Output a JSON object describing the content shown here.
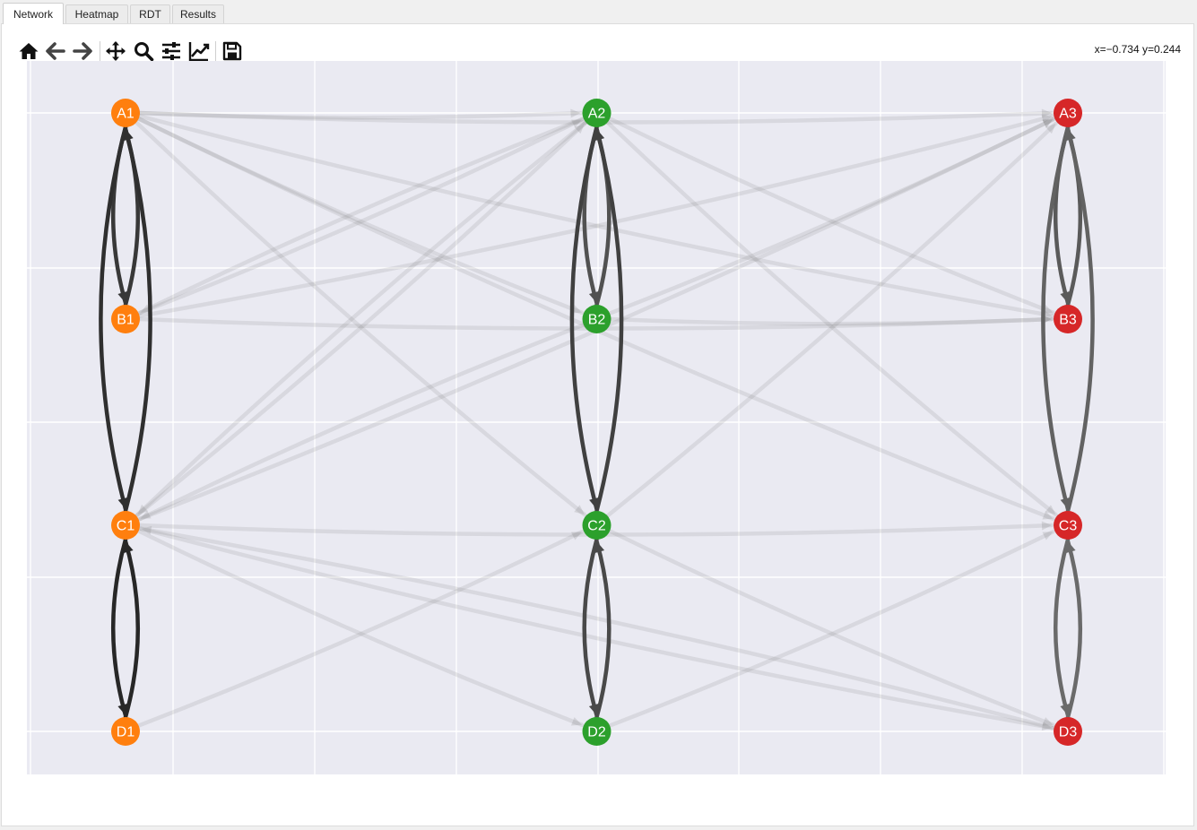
{
  "tabs": [
    {
      "label": "Network",
      "active": true
    },
    {
      "label": "Heatmap",
      "active": false
    },
    {
      "label": "RDT",
      "active": false
    },
    {
      "label": "Results",
      "active": false
    }
  ],
  "toolbar": {
    "tools": [
      {
        "name": "home",
        "icon": "home-icon"
      },
      {
        "name": "back",
        "icon": "arrow-left-icon"
      },
      {
        "name": "forward",
        "icon": "arrow-right-icon"
      },
      {
        "name": "pan",
        "icon": "move-icon"
      },
      {
        "name": "zoom",
        "icon": "magnifier-icon"
      },
      {
        "name": "subplots",
        "icon": "sliders-icon"
      },
      {
        "name": "axes",
        "icon": "line-chart-icon"
      },
      {
        "name": "save",
        "icon": "floppy-disk-icon"
      }
    ],
    "coordinates": "x=−0.734 y=0.244"
  },
  "colors": {
    "group1": "#ff7f0e",
    "group2": "#2ca02c",
    "group3": "#d62728",
    "plot_background": "#eaeaf2",
    "grid": "#ffffff"
  },
  "chart_data": {
    "type": "network",
    "nodes": [
      {
        "id": "A1",
        "x": 0,
        "y": 3,
        "group": 1
      },
      {
        "id": "B1",
        "x": 0,
        "y": 2,
        "group": 1
      },
      {
        "id": "C1",
        "x": 0,
        "y": 1,
        "group": 1
      },
      {
        "id": "D1",
        "x": 0,
        "y": 0,
        "group": 1
      },
      {
        "id": "A2",
        "x": 1,
        "y": 3,
        "group": 2
      },
      {
        "id": "B2",
        "x": 1,
        "y": 2,
        "group": 2
      },
      {
        "id": "C2",
        "x": 1,
        "y": 1,
        "group": 2
      },
      {
        "id": "D2",
        "x": 1,
        "y": 0,
        "group": 2
      },
      {
        "id": "A3",
        "x": 2,
        "y": 3,
        "group": 3
      },
      {
        "id": "B3",
        "x": 2,
        "y": 2,
        "group": 3
      },
      {
        "id": "C3",
        "x": 2,
        "y": 1,
        "group": 3
      },
      {
        "id": "D3",
        "x": 2,
        "y": 0,
        "group": 3
      }
    ],
    "strong_edges": [
      {
        "from": "A1",
        "to": "B1",
        "weight": 0.85
      },
      {
        "from": "B1",
        "to": "A1",
        "weight": 0.85
      },
      {
        "from": "A1",
        "to": "C1",
        "weight": 0.9
      },
      {
        "from": "C1",
        "to": "A1",
        "weight": 0.9
      },
      {
        "from": "C1",
        "to": "D1",
        "weight": 0.95
      },
      {
        "from": "D1",
        "to": "C1",
        "weight": 0.95
      },
      {
        "from": "A2",
        "to": "B2",
        "weight": 0.7
      },
      {
        "from": "B2",
        "to": "A2",
        "weight": 0.7
      },
      {
        "from": "A2",
        "to": "C2",
        "weight": 0.8
      },
      {
        "from": "C2",
        "to": "A2",
        "weight": 0.8
      },
      {
        "from": "C2",
        "to": "D2",
        "weight": 0.75
      },
      {
        "from": "D2",
        "to": "C2",
        "weight": 0.75
      },
      {
        "from": "A3",
        "to": "B3",
        "weight": 0.65
      },
      {
        "from": "B3",
        "to": "A3",
        "weight": 0.65
      },
      {
        "from": "A3",
        "to": "C3",
        "weight": 0.6
      },
      {
        "from": "C3",
        "to": "A3",
        "weight": 0.6
      },
      {
        "from": "C3",
        "to": "D3",
        "weight": 0.55
      },
      {
        "from": "D3",
        "to": "C3",
        "weight": 0.55
      }
    ],
    "weak_edges": [
      [
        "A1",
        "A2"
      ],
      [
        "A1",
        "A3"
      ],
      [
        "A1",
        "B2"
      ],
      [
        "A1",
        "B3"
      ],
      [
        "A1",
        "C2"
      ],
      [
        "A1",
        "C3"
      ],
      [
        "B1",
        "A2"
      ],
      [
        "B1",
        "A3"
      ],
      [
        "B1",
        "B3"
      ],
      [
        "C1",
        "A2"
      ],
      [
        "C1",
        "A3"
      ],
      [
        "C1",
        "C3"
      ],
      [
        "C1",
        "D2"
      ],
      [
        "C1",
        "D3"
      ],
      [
        "D1",
        "C2"
      ],
      [
        "A2",
        "B3"
      ],
      [
        "A2",
        "C3"
      ],
      [
        "B2",
        "A3"
      ],
      [
        "B2",
        "B3"
      ],
      [
        "C2",
        "A3"
      ],
      [
        "C2",
        "D3"
      ],
      [
        "D2",
        "C3"
      ],
      [
        "A2",
        "C1"
      ],
      [
        "A2",
        "B1"
      ],
      [
        "B2",
        "C1"
      ],
      [
        "D3",
        "C1"
      ]
    ],
    "grid": true,
    "xlim": [
      -0.2,
      2.2
    ],
    "ylim": [
      -0.2,
      3.25
    ]
  }
}
